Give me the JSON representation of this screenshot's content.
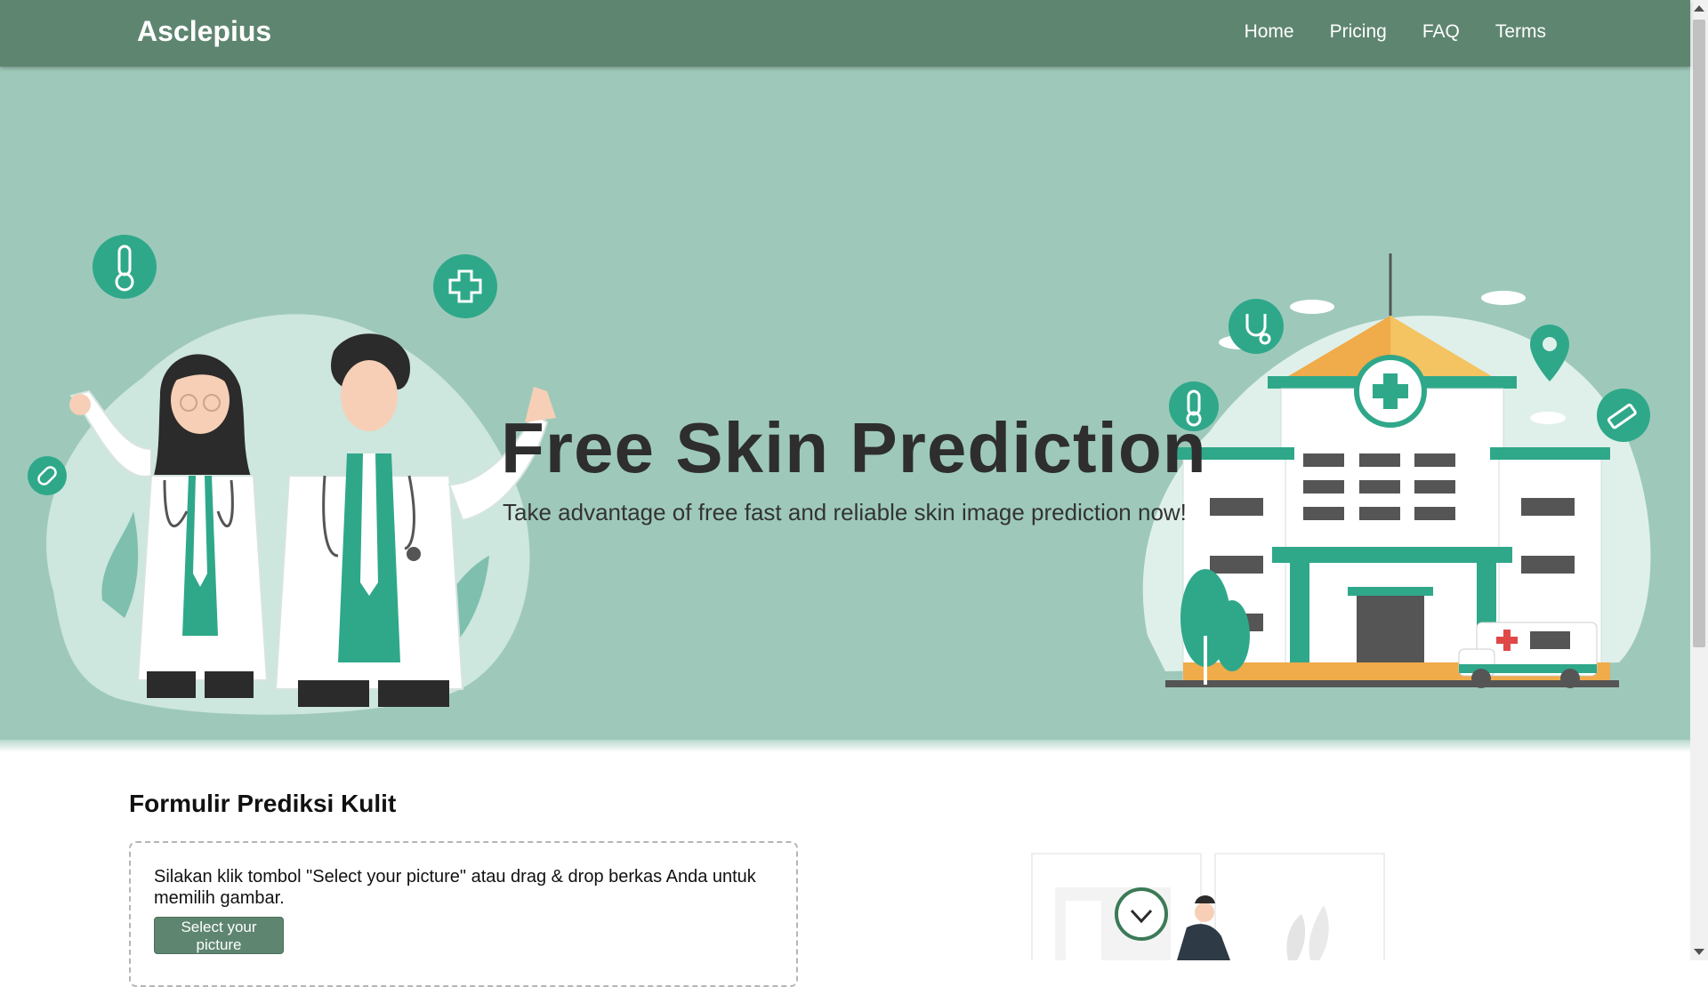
{
  "navbar": {
    "brand": "Asclepius",
    "links": [
      "Home",
      "Pricing",
      "FAQ",
      "Terms"
    ]
  },
  "hero": {
    "title": "Free Skin Prediction",
    "subtitle": "Take advantage of free fast and reliable skin image prediction now!"
  },
  "form": {
    "title": "Formulir Prediksi Kulit",
    "instruction": "Silakan klik tombol \"Select your picture\" atau drag & drop berkas Anda untuk memilih gambar.",
    "select_button": "Select your picture"
  },
  "colors": {
    "navbar": "#5e8570",
    "hero_bg": "#9ec9ba",
    "accent_teal": "#2fa88a",
    "button": "#5e8570"
  },
  "icons": [
    "thermometer-icon",
    "medical-cross-icon",
    "pill-icon",
    "stethoscope-icon",
    "location-pin-icon",
    "syringe-icon",
    "clock-check-icon"
  ]
}
